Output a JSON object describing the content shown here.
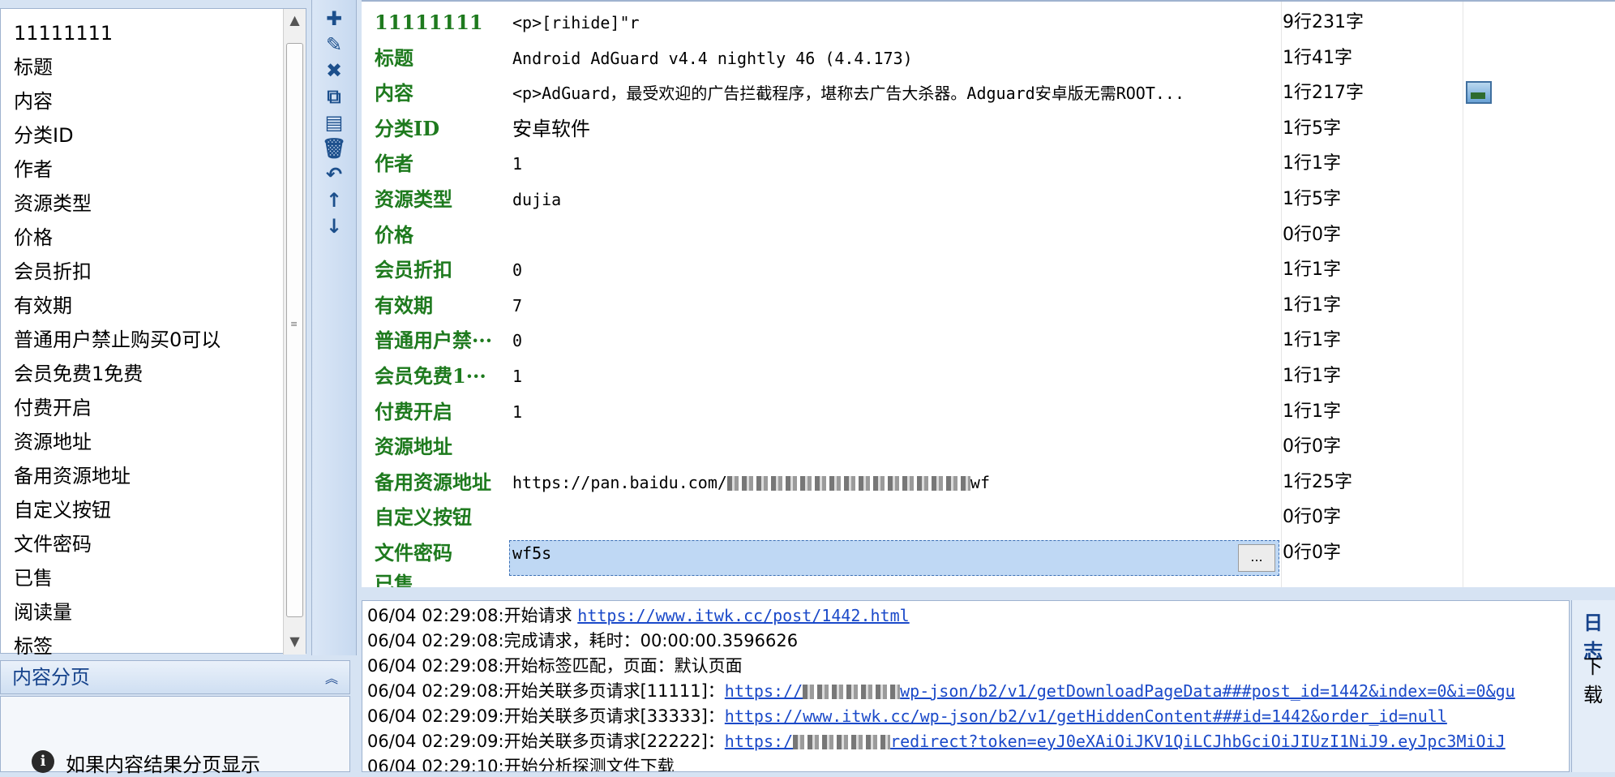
{
  "left_list": {
    "items": [
      "11111111",
      "标题",
      "内容",
      "分类ID",
      "作者",
      "资源类型",
      "价格",
      "会员折扣",
      "有效期",
      "普通用户禁止购买0可以",
      "会员免费1免费",
      "付费开启",
      "资源地址",
      "备用资源地址",
      "自定义按钮",
      "文件密码",
      "已售",
      "阅读量",
      "标签"
    ]
  },
  "pager": {
    "title": "内容分页",
    "collapse_icon": "double-chevron-up",
    "info_text": "如果内容结果分页显示",
    "info_icon": "info"
  },
  "toolbar": {
    "buttons": [
      "add",
      "edit",
      "delete",
      "copy",
      "paste",
      "trash",
      "undo",
      "move-up",
      "move-down"
    ]
  },
  "grid": {
    "rows": [
      {
        "name": "11111111",
        "value": "<p>[rihide]\"r",
        "stat": "9行231字"
      },
      {
        "name": "标题",
        "value": "Android AdGuard v4.4 nightly 46 (4.4.173)",
        "stat": "1行41字"
      },
      {
        "name": "内容",
        "value": "<p>AdGuard，最受欢迎的广告拦截程序，堪称去广告大杀器。Adguard安卓版无需ROOT...",
        "stat": "1行217字"
      },
      {
        "name": "分类ID",
        "value": "安卓软件",
        "stat": "1行5字"
      },
      {
        "name": "作者",
        "value": "1",
        "stat": "1行1字"
      },
      {
        "name": "资源类型",
        "value": "dujia",
        "stat": "1行5字"
      },
      {
        "name": "价格",
        "value": "",
        "stat": "0行0字"
      },
      {
        "name": "会员折扣",
        "value": "0",
        "stat": "1行1字"
      },
      {
        "name": "有效期",
        "value": "7",
        "stat": "1行1字"
      },
      {
        "name": "普通用户禁···",
        "value": "0",
        "stat": "1行1字"
      },
      {
        "name": "会员免费1···",
        "value": "1",
        "stat": "1行1字"
      },
      {
        "name": "付费开启",
        "value": "1",
        "stat": "1行1字"
      },
      {
        "name": "资源地址",
        "value": "",
        "stat": "0行0字"
      },
      {
        "name": "备用资源地址",
        "value": "https://pan.baidu.com/",
        "value_tail": "wf",
        "stat": "1行25字"
      },
      {
        "name": "自定义按钮",
        "value": "",
        "stat": "0行0字"
      },
      {
        "name": "文件密码",
        "value": "wf5s",
        "stat": "0行0字"
      }
    ],
    "ellipsis_button": "..."
  },
  "log": {
    "lines": [
      {
        "time": "06/04 02:29:08:",
        "text": "开始请求 ",
        "link": "https://www.itwk.cc/post/1442.html"
      },
      {
        "time": "06/04 02:29:08:",
        "text": "完成请求，耗时：00:00:00.3596626",
        "link": ""
      },
      {
        "time": "06/04 02:29:08:",
        "text": "开始标签匹配，页面：默认页面",
        "link": ""
      },
      {
        "time": "06/04 02:29:08:",
        "text": "开始关联多页请求[11111]：",
        "link": "https://",
        "link_tail": "wp-json/b2/v1/getDownloadPageData###post_id=1442&index=0&i=0&gu"
      },
      {
        "time": "06/04 02:29:09:",
        "text": "开始关联多页请求[33333]：",
        "link": "https://www.itwk.cc/wp-json/b2/v1/getHiddenContent###id=1442&order_id=null"
      },
      {
        "time": "06/04 02:29:09:",
        "text": "开始关联多页请求[22222]：",
        "link": "https:/",
        "link_tail": "redirect?token=eyJ0eXAiOiJKV1QiLCJhbGciOiJIUzI1NiJ9.eyJpc3MiOiJ"
      },
      {
        "time": "06/04 02:29:10:",
        "text": "开始分析探测文件下载",
        "link": ""
      }
    ]
  },
  "right_panel": {
    "title": "日志",
    "label": "下载"
  },
  "colors": {
    "field_name_green": "#1e7a1e",
    "selection_blue": "#bfd8f4",
    "link_blue": "#1a49c9",
    "panel_blue": "#d6e3f3"
  }
}
